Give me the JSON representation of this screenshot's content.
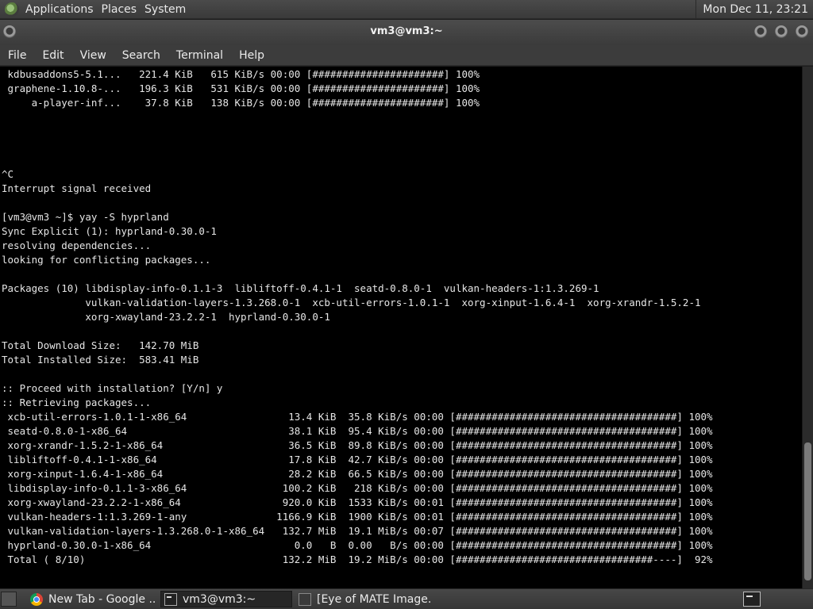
{
  "top_panel": {
    "menus": [
      "Applications",
      "Places",
      "System"
    ],
    "clock": "Mon Dec 11, 23:21"
  },
  "window": {
    "title": "vm3@vm3:~",
    "menu": [
      "File",
      "Edit",
      "View",
      "Search",
      "Terminal",
      "Help"
    ]
  },
  "terminal": {
    "scrollbar_thumb": {
      "start_fraction": 0.72,
      "end_fraction": 0.985
    },
    "lines": [
      " kdbusaddons5-5.1...   221.4 KiB   615 KiB/s 00:00 [######################] 100%",
      " graphene-1.10.8-...   196.3 KiB   531 KiB/s 00:00 [######################] 100%",
      "     a-player-inf...    37.8 KiB   138 KiB/s 00:00 [######################] 100%",
      "",
      "",
      "",
      "",
      "^C",
      "Interrupt signal received",
      "",
      "[vm3@vm3 ~]$ yay -S hyprland",
      "Sync Explicit (1): hyprland-0.30.0-1",
      "resolving dependencies...",
      "looking for conflicting packages...",
      "",
      "Packages (10) libdisplay-info-0.1.1-3  libliftoff-0.4.1-1  seatd-0.8.0-1  vulkan-headers-1:1.3.269-1",
      "              vulkan-validation-layers-1.3.268.0-1  xcb-util-errors-1.0.1-1  xorg-xinput-1.6.4-1  xorg-xrandr-1.5.2-1",
      "              xorg-xwayland-23.2.2-1  hyprland-0.30.0-1",
      "",
      "Total Download Size:   142.70 MiB",
      "Total Installed Size:  583.41 MiB",
      "",
      ":: Proceed with installation? [Y/n] y",
      ":: Retrieving packages...",
      " xcb-util-errors-1.0.1-1-x86_64                 13.4 KiB  35.8 KiB/s 00:00 [#####################################] 100%",
      " seatd-0.8.0-1-x86_64                           38.1 KiB  95.4 KiB/s 00:00 [#####################################] 100%",
      " xorg-xrandr-1.5.2-1-x86_64                     36.5 KiB  89.8 KiB/s 00:00 [#####################################] 100%",
      " libliftoff-0.4.1-1-x86_64                      17.8 KiB  42.7 KiB/s 00:00 [#####################################] 100%",
      " xorg-xinput-1.6.4-1-x86_64                     28.2 KiB  66.5 KiB/s 00:00 [#####################################] 100%",
      " libdisplay-info-0.1.1-3-x86_64                100.2 KiB   218 KiB/s 00:00 [#####################################] 100%",
      " xorg-xwayland-23.2.2-1-x86_64                 920.0 KiB  1533 KiB/s 00:01 [#####################################] 100%",
      " vulkan-headers-1:1.3.269-1-any               1166.9 KiB  1900 KiB/s 00:01 [#####################################] 100%",
      " vulkan-validation-layers-1.3.268.0-1-x86_64   132.7 MiB  19.1 MiB/s 00:07 [#####################################] 100%",
      " hyprland-0.30.0-1-x86_64                        0.0   B  0.00   B/s 00:00 [#####################################] 100%",
      " Total ( 8/10)                                 132.2 MiB  19.2 MiB/s 00:00 [#################################----]  92%"
    ]
  },
  "taskbar": {
    "tasks": [
      {
        "label": "New Tab - Google ...",
        "icon": "chrome-icon",
        "active": false
      },
      {
        "label": "vm3@vm3:~",
        "icon": "terminal-icon",
        "active": true
      },
      {
        "label": "[Eye of MATE Image...",
        "icon": "image-viewer-icon",
        "active": false
      }
    ]
  }
}
